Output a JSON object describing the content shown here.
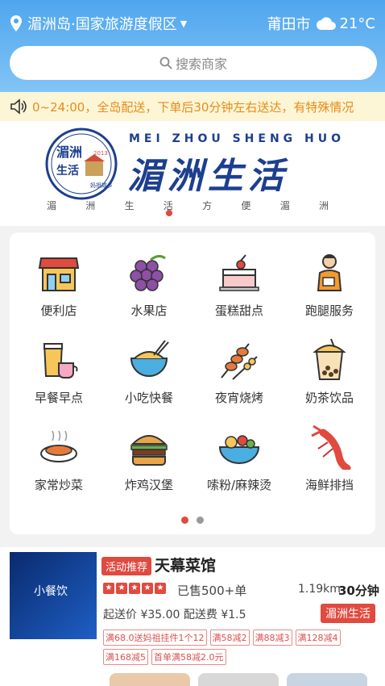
{
  "header": {
    "location": "湄洲岛·国家旅游度假区",
    "city": "莆田市",
    "temperature": "21°C",
    "search_placeholder": "搜索商家"
  },
  "notice": "0~24:00，全岛配送，下单后30分钟左右送达，有特殊情况",
  "brand": {
    "english": "MEI ZHOU SHENG HUO",
    "chinese": "湄洲生活",
    "seal_top": "湄洲",
    "seal_bottom": "生活",
    "seal_year": "2013",
    "seal_caption": "妈祖故乡",
    "slogan": [
      "湄",
      "洲",
      "生",
      "活",
      "方",
      "便",
      "湄",
      "洲"
    ]
  },
  "categories": [
    {
      "label": "便利店",
      "icon": "store-icon"
    },
    {
      "label": "水果店",
      "icon": "grape-icon"
    },
    {
      "label": "蛋糕甜点",
      "icon": "cake-icon"
    },
    {
      "label": "跑腿服务",
      "icon": "courier-icon"
    },
    {
      "label": "早餐早点",
      "icon": "breakfast-icon"
    },
    {
      "label": "小吃快餐",
      "icon": "noodle-bowl-icon"
    },
    {
      "label": "夜宵烧烤",
      "icon": "skewer-icon"
    },
    {
      "label": "奶茶饮品",
      "icon": "milk-tea-icon"
    },
    {
      "label": "家常炒菜",
      "icon": "home-dish-icon"
    },
    {
      "label": "炸鸡汉堡",
      "icon": "burger-icon"
    },
    {
      "label": "嗦粉/麻辣烫",
      "icon": "hotpot-bowl-icon"
    },
    {
      "label": "海鲜排挡",
      "icon": "lobster-icon"
    }
  ],
  "shop": {
    "tag": "活动推荐",
    "name": "天幕菜馆",
    "rating": 5,
    "sold": "已售500+单",
    "distance": "1.19km",
    "time": "30分钟",
    "fee": "起送价 ¥35.00  配送费 ¥1.5",
    "area": "湄洲生活",
    "thumb_text": "小餐饮",
    "promos": [
      "满68.0送妈祖挂件1个12",
      "满58减2",
      "满88减3",
      "满128减4",
      "满168减5",
      "首单满58减2.0元"
    ]
  },
  "colors": {
    "accent": "#e04a3f",
    "header": "#4fa6ee",
    "brand": "#1d3f8f",
    "notice": "#e88b1a"
  }
}
